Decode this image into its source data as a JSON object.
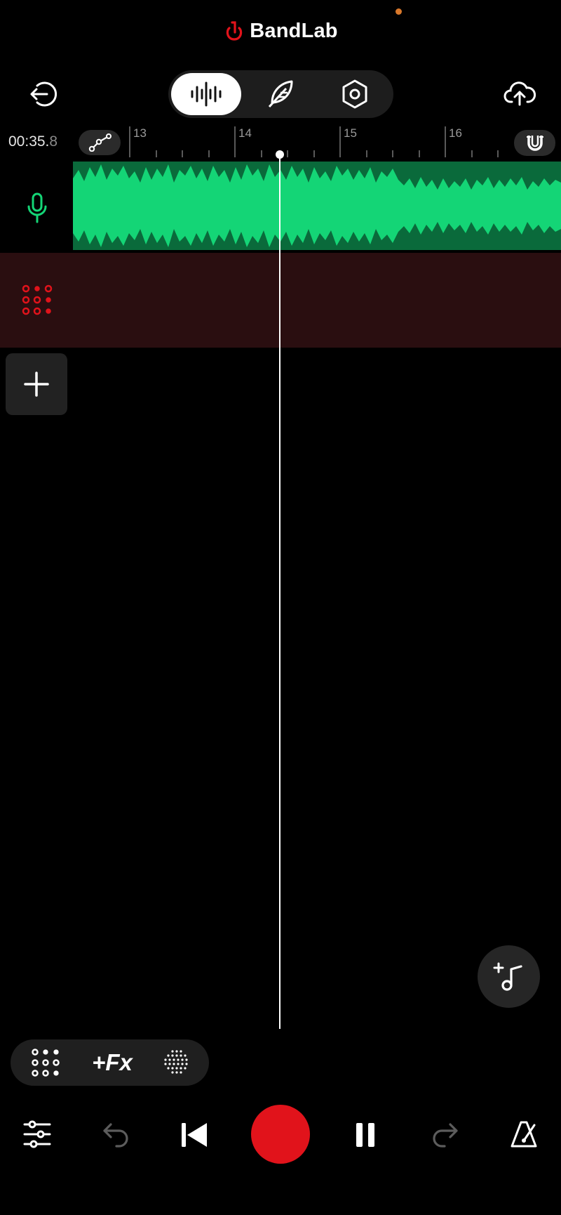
{
  "app": {
    "brand_name": "BandLab",
    "accent_color": "#e1131b",
    "status_dot_color": "#d9782b"
  },
  "header": {
    "exit_icon": "exit-icon",
    "upload_icon": "cloud-upload-icon",
    "modes": [
      {
        "name": "waveform-mode",
        "icon": "waveform-icon",
        "active": true
      },
      {
        "name": "feather-mode",
        "icon": "feather-icon",
        "active": false
      },
      {
        "name": "settings-mode",
        "icon": "hex-nut-icon",
        "active": false
      }
    ]
  },
  "timeline": {
    "time_main": "00:35.",
    "time_frac": "8",
    "bar_labels": [
      "13",
      "14",
      "15",
      "16"
    ],
    "automation_icon": "automation-icon",
    "snap_icon": "magnet-icon"
  },
  "tracks": [
    {
      "name": "Voice track",
      "icon": "microphone-icon",
      "color": "#14d576",
      "clip_color": "#0a6a3b"
    },
    {
      "name": "Drum track",
      "icon": "drum-pad-icon",
      "color": "#e1131b",
      "background": "#2a0e10"
    }
  ],
  "bottom_tools": {
    "drum_pad_icon": "drum-pad-icon",
    "fx_label": "+Fx",
    "texture_icon": "dots-circle-icon"
  },
  "transport": {
    "mixer_icon": "mixer-sliders-icon",
    "undo_icon": "undo-icon",
    "rewind_icon": "skip-back-icon",
    "record_icon": "record-icon",
    "pause_icon": "pause-icon",
    "redo_icon": "redo-icon",
    "metronome_icon": "metronome-icon"
  },
  "fab": {
    "icon": "add-music-note-icon"
  }
}
